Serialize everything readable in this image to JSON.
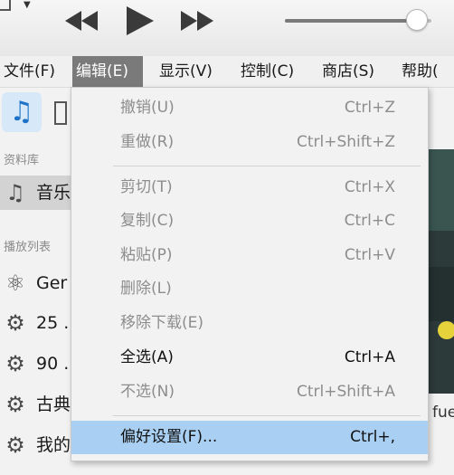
{
  "toolbar": {
    "prev_icon": "rewind-icon",
    "play_icon": "play-icon",
    "next_icon": "fast-forward-icon",
    "volume": 0.9
  },
  "menubar": {
    "items": [
      {
        "label": "文件(F)"
      },
      {
        "label": "编辑(E)"
      },
      {
        "label": "显示(V)"
      },
      {
        "label": "控制(C)"
      },
      {
        "label": "商店(S)"
      },
      {
        "label": "帮助("
      }
    ]
  },
  "sidebar": {
    "library_header": "资料库",
    "music_label": "音乐",
    "playlists_header": "播放列表",
    "playlists": [
      {
        "icon": "atom-icon",
        "label": "Ger"
      },
      {
        "icon": "gear-icon",
        "label": "25 ."
      },
      {
        "icon": "gear-icon",
        "label": "90 ."
      },
      {
        "icon": "gear-icon",
        "label": "古典"
      },
      {
        "icon": "gear-icon",
        "label": "我的"
      }
    ]
  },
  "content": {
    "partial_text": "fue"
  },
  "edit_menu": {
    "items": [
      {
        "label": "撤销(U)",
        "shortcut": "Ctrl+Z",
        "enabled": false
      },
      {
        "label": "重做(R)",
        "shortcut": "Ctrl+Shift+Z",
        "enabled": false
      },
      {
        "label": "剪切(T)",
        "shortcut": "Ctrl+X",
        "enabled": false
      },
      {
        "label": "复制(C)",
        "shortcut": "Ctrl+C",
        "enabled": false
      },
      {
        "label": "粘贴(P)",
        "shortcut": "Ctrl+V",
        "enabled": false
      },
      {
        "label": "删除(L)",
        "shortcut": "",
        "enabled": false
      },
      {
        "label": "移除下载(E)",
        "shortcut": "",
        "enabled": false
      },
      {
        "label": "全选(A)",
        "shortcut": "Ctrl+A",
        "enabled": true
      },
      {
        "label": "不选(N)",
        "shortcut": "Ctrl+Shift+A",
        "enabled": false
      },
      {
        "label": "偏好设置(F)...",
        "shortcut": "Ctrl+,",
        "enabled": true,
        "highlighted": true
      }
    ]
  }
}
